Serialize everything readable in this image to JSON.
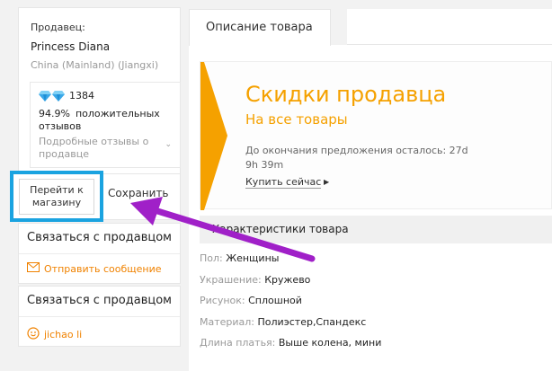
{
  "seller": {
    "label": "Продавец:",
    "name": "Princess Diana",
    "location": "China (Mainland) (Jiangxi)",
    "rating_count": "1384",
    "positive_pct": "94.9%",
    "positive_text": "положительных отзывов",
    "detailed_reviews": "Подробные отзывы о продавце"
  },
  "actions": {
    "goto_store": "Перейти к магазину",
    "save": "Сохранить"
  },
  "contact1": {
    "title": "Связаться с продавцом",
    "send_message": "Отправить сообщение"
  },
  "contact2": {
    "title": "Связаться с продавцом",
    "user": "jichao li"
  },
  "tabs": {
    "description": "Описание товара"
  },
  "promo": {
    "title": "Скидки продавца",
    "subtitle": "На все товары",
    "timer": "До окончания предложения осталось: 27d 9h 39m",
    "buy_now": "Купить сейчас"
  },
  "specs": {
    "header": "Характеристики товара",
    "rows": [
      {
        "key": "Пол:",
        "value": "Женщины"
      },
      {
        "key": "Украшение:",
        "value": "Кружево"
      },
      {
        "key": "Рисунок:",
        "value": "Сплошной"
      },
      {
        "key": "Материал:",
        "value": "Полиэстер,Спандекс"
      },
      {
        "key": "Длина платья:",
        "value": "Выше колена, мини"
      }
    ]
  },
  "icons": {
    "diamond": "diamond-icon",
    "envelope": "envelope-icon",
    "user": "smiley-user-icon",
    "chevron": "chevron-down-icon"
  },
  "colors": {
    "accent_orange": "#f5a100",
    "link_orange": "#f08200",
    "highlight_blue": "#1aa3e0",
    "annotation_purple": "#a020c8"
  }
}
